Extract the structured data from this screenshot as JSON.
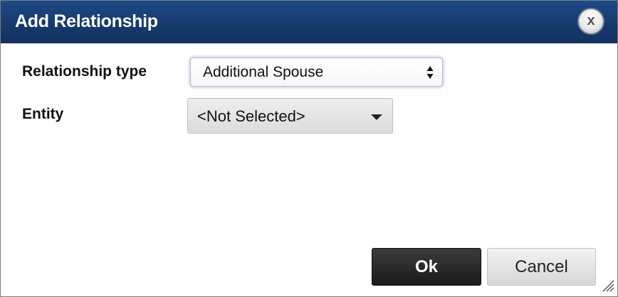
{
  "dialog": {
    "title": "Add Relationship",
    "close_label": "x"
  },
  "form": {
    "relationship_type": {
      "label": "Relationship type",
      "selected": "Additional Spouse"
    },
    "entity": {
      "label": "Entity",
      "selected": "<Not Selected>"
    }
  },
  "buttons": {
    "ok_label": "Ok",
    "cancel_label": "Cancel"
  },
  "icons": {
    "close": "close-icon",
    "select_arrows": "updown-arrows-icon",
    "dropdown": "chevron-down-icon",
    "resize": "resize-grip-icon"
  },
  "colors": {
    "titlebar": "#163a6e",
    "ok_button": "#1a1a1a",
    "cancel_button": "#e3e3e3"
  }
}
